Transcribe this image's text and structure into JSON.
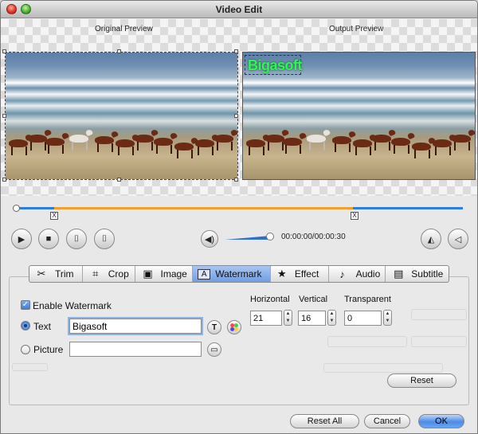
{
  "window": {
    "title": "Video Edit"
  },
  "preview": {
    "original_label": "Original Preview",
    "output_label": "Output Preview",
    "watermark_overlay_text": "Bigasoft"
  },
  "playback": {
    "timecode": "00:00:00/00:00:30",
    "volume_fraction": 1.0,
    "trim_marker_symbol": "X",
    "buttons": {
      "play": "play-icon",
      "stop": "stop-icon",
      "mark_start": "trim-start-icon",
      "mark_end": "trim-end-icon",
      "flip": "flip-icon",
      "rotate": "rotate-icon"
    }
  },
  "tabs": [
    {
      "label": "Trim",
      "icon": "scissors-icon",
      "glyph": "✂"
    },
    {
      "label": "Crop",
      "icon": "crop-icon",
      "glyph": "⌗"
    },
    {
      "label": "Image",
      "icon": "image-icon",
      "glyph": "▣"
    },
    {
      "label": "Watermark",
      "icon": "watermark-icon",
      "glyph": "A",
      "active": true
    },
    {
      "label": "Effect",
      "icon": "star-icon",
      "glyph": "★"
    },
    {
      "label": "Audio",
      "icon": "music-note-icon",
      "glyph": "♪"
    },
    {
      "label": "Subtitle",
      "icon": "subtitle-icon",
      "glyph": "▤"
    }
  ],
  "watermark": {
    "enable_label": "Enable Watermark",
    "enabled": true,
    "text_option_label": "Text",
    "text_value": "Bigasoft",
    "picture_option_label": "Picture",
    "picture_value": "",
    "selected_type": "Text",
    "horizontal_label": "Horizontal",
    "horizontal_value": "21",
    "vertical_label": "Vertical",
    "vertical_value": "16",
    "transparent_label": "Transparent",
    "transparent_value": "0",
    "reset_label": "Reset"
  },
  "footer": {
    "reset_all_label": "Reset All",
    "cancel_label": "Cancel",
    "ok_label": "OK"
  },
  "colors": {
    "watermark_text": "#35f15b",
    "timeline_blue": "#2f7de0",
    "timeline_orange": "#f0a030",
    "active_tab": "#6f9ee2",
    "ok_button": "#4d8be6"
  }
}
